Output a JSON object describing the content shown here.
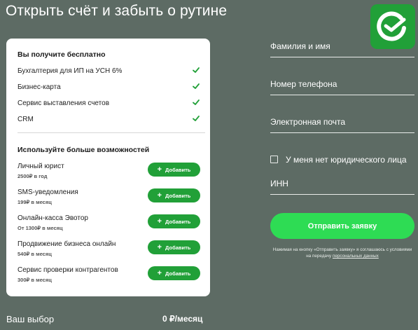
{
  "page": {
    "title": "Открыть счёт и забыть о рутине"
  },
  "brand": {
    "logo_icon": "sber-logo-icon",
    "accent": "#21a038"
  },
  "card": {
    "free_heading": "Вы получите бесплатно",
    "free_items": [
      {
        "label": "Бухгалтерия для ИП на УСН 6%",
        "icon": "checkmark-icon"
      },
      {
        "label": "Бизнес-карта",
        "icon": "checkmark-icon"
      },
      {
        "label": "Сервис выставления счетов",
        "icon": "checkmark-icon"
      },
      {
        "label": "CRM",
        "icon": "checkmark-icon"
      }
    ],
    "more_heading": "Используйте больше возможностей",
    "options": [
      {
        "name": "Личный юрист",
        "price": "2500₽ в год",
        "button": "Добавить"
      },
      {
        "name": "SMS-уведомления",
        "price": "199₽ в месяц",
        "button": "Добавить"
      },
      {
        "name": "Онлайн-касса Эвотор",
        "price": "От 1300₽ в месяц",
        "button": "Добавить"
      },
      {
        "name": "Продвижение бизнеса онлайн",
        "price": "540₽ в месяц",
        "button": "Добавить"
      },
      {
        "name": "Сервис проверки контрагентов",
        "price": "300₽ в месяц",
        "button": "Добавить"
      }
    ]
  },
  "summary": {
    "label": "Ваш выбор",
    "value": "0 ₽/месяц"
  },
  "form": {
    "name_placeholder": "Фамилия и имя",
    "phone_placeholder": "Номер телефона",
    "email_placeholder": "Электронная почта",
    "no_entity_label": "У меня нет юридического лица",
    "inn_placeholder": "ИНН",
    "submit_label": "Отправить заявку",
    "terms_prefix": "Нажимая на кнопку «Отправить заявку» я соглашаюсь с условиями на передачу ",
    "terms_link": "персональных данных"
  }
}
